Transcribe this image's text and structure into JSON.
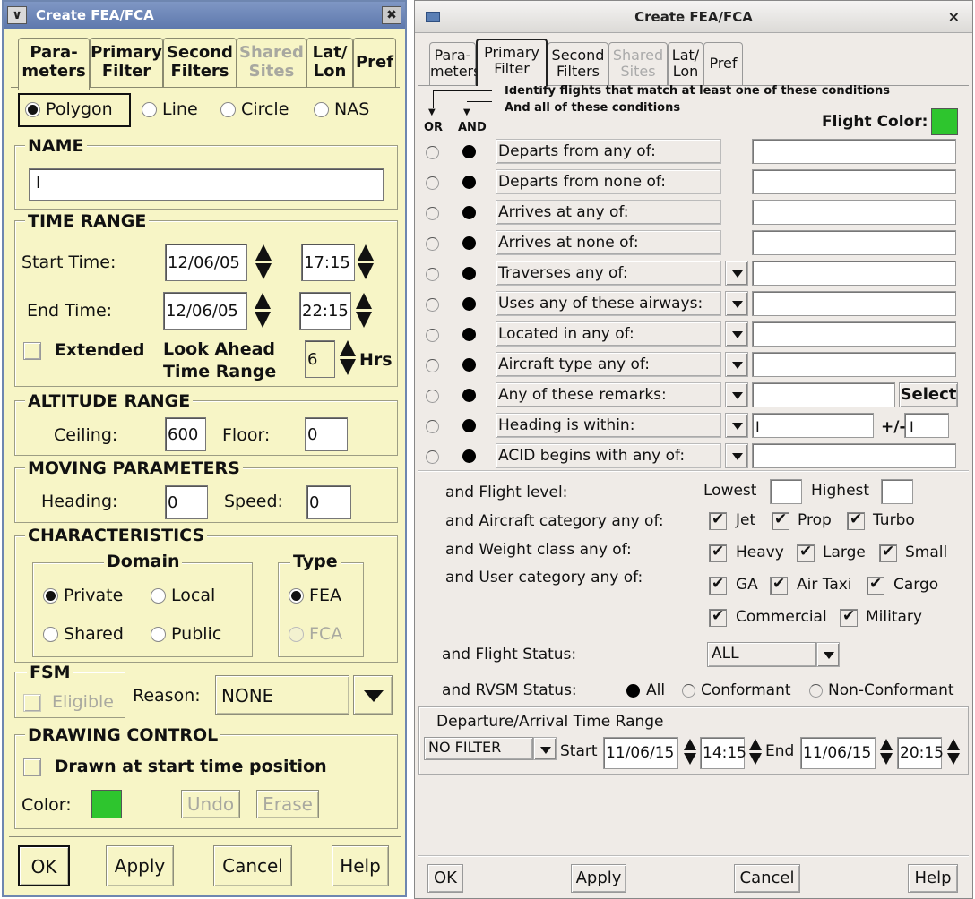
{
  "left_window": {
    "title": "Create FEA/FCA",
    "minimize_glyph": "∨",
    "close_glyph": "✖",
    "tabs": [
      {
        "label_line1": "Para-",
        "label_line2": "meters",
        "state": "active"
      },
      {
        "label_line1": "Primary",
        "label_line2": "Filter",
        "state": "normal"
      },
      {
        "label_line1": "Second",
        "label_line2": "Filters",
        "state": "normal"
      },
      {
        "label_line1": "Shared",
        "label_line2": "Sites",
        "state": "disabled"
      },
      {
        "label_line1": "Lat/",
        "label_line2": "Lon",
        "state": "normal"
      },
      {
        "label_line1": "Pref",
        "label_line2": "",
        "state": "normal"
      }
    ],
    "shape_options": [
      "Polygon",
      "Line",
      "Circle",
      "NAS"
    ],
    "shape_selected": "Polygon",
    "name_section": {
      "label": "NAME",
      "value": ""
    },
    "time_range": {
      "label": "TIME RANGE",
      "start_label": "Start Time:",
      "start_date": "12/06/05",
      "start_time": "17:15",
      "end_label": "End Time:",
      "end_date": "12/06/05",
      "end_time": "22:15",
      "extended_label": "Extended",
      "look_ahead_label_1": "Look Ahead",
      "look_ahead_label_2": "Time Range",
      "look_ahead_value": "6",
      "hrs_label": "Hrs"
    },
    "altitude_range": {
      "label": "ALTITUDE RANGE",
      "ceiling_label": "Ceiling:",
      "ceiling_value": "600",
      "floor_label": "Floor:",
      "floor_value": "0"
    },
    "moving_parameters": {
      "label": "MOVING PARAMETERS",
      "heading_label": "Heading:",
      "heading_value": "0",
      "speed_label": "Speed:",
      "speed_value": "0"
    },
    "characteristics": {
      "label": "CHARACTERISTICS",
      "domain_label": "Domain",
      "domain_options": [
        "Private",
        "Local",
        "Shared",
        "Public"
      ],
      "domain_selected": "Private",
      "type_label": "Type",
      "type_options": [
        "FEA",
        "FCA"
      ],
      "type_selected": "FEA"
    },
    "fsm": {
      "label": "FSM",
      "eligible_label": "Eligible",
      "reason_label": "Reason:",
      "reason_value": "NONE"
    },
    "drawing_control": {
      "label": "DRAWING CONTROL",
      "drawn_label": "Drawn at start time position",
      "color_label": "Color:",
      "color": "#2ec52e",
      "undo_label": "Undo",
      "erase_label": "Erase"
    },
    "buttons": {
      "ok": "OK",
      "apply": "Apply",
      "cancel": "Cancel",
      "help": "Help"
    }
  },
  "right_window": {
    "title": "Create FEA/FCA",
    "close_glyph": "×",
    "tabs": [
      {
        "label_line1": "Para-",
        "label_line2": "meters",
        "state": "normal"
      },
      {
        "label_line1": "Primary",
        "label_line2": "Filter",
        "state": "active"
      },
      {
        "label_line1": "Second",
        "label_line2": "Filters",
        "state": "normal"
      },
      {
        "label_line1": "Shared",
        "label_line2": "Sites",
        "state": "disabled"
      },
      {
        "label_line1": "Lat/",
        "label_line2": "Lon",
        "state": "normal"
      },
      {
        "label_line1": "Pref",
        "label_line2": "",
        "state": "normal"
      }
    ],
    "or_label": "OR",
    "and_label": "AND",
    "legend_line1": "Identify flights that match at least one of these conditions",
    "legend_line2": "And all of these conditions",
    "flight_color_label": "Flight Color:",
    "flight_color": "#2ec52e",
    "conditions": [
      {
        "label": "Departs from any of:",
        "dropdown": false,
        "value": ""
      },
      {
        "label": "Departs from none of:",
        "dropdown": false,
        "value": ""
      },
      {
        "label": "Arrives at any of:",
        "dropdown": false,
        "value": ""
      },
      {
        "label": "Arrives at none of:",
        "dropdown": false,
        "value": ""
      },
      {
        "label": "Traverses any of:",
        "dropdown": true,
        "value": ""
      },
      {
        "label": "Uses any of these airways:",
        "dropdown": true,
        "value": ""
      },
      {
        "label": "Located in any of:",
        "dropdown": true,
        "value": ""
      },
      {
        "label": "Aircraft type any of:",
        "dropdown": true,
        "value": ""
      },
      {
        "label": "Any of these remarks:",
        "dropdown": true,
        "value": ""
      },
      {
        "label": "Heading is within:",
        "dropdown": true,
        "value": ""
      },
      {
        "label": "ACID begins with any of:",
        "dropdown": true,
        "value": ""
      }
    ],
    "select_button": "Select",
    "plus_minus_label": "+/-",
    "flight_level_label": "and Flight level:",
    "lowest_label": "Lowest",
    "highest_label": "Highest",
    "aircraft_category_label": "and Aircraft category any of:",
    "aircraft_categories": [
      "Jet",
      "Prop",
      "Turbo"
    ],
    "weight_class_label": "and Weight class any of:",
    "weight_classes": [
      "Heavy",
      "Large",
      "Small"
    ],
    "user_category_label": "and User category any of:",
    "user_categories_row1": [
      "GA",
      "Air Taxi",
      "Cargo"
    ],
    "user_categories_row2": [
      "Commercial",
      "Military"
    ],
    "flight_status_label": "and Flight Status:",
    "flight_status_value": "ALL",
    "rvsm_label": "and RVSM Status:",
    "rvsm_options": [
      "All",
      "Conformant",
      "Non-Conformant"
    ],
    "rvsm_selected": "All",
    "dep_arr": {
      "label": "Departure/Arrival Time Range",
      "filter_value": "NO FILTER",
      "start_label": "Start",
      "start_date": "11/06/15",
      "start_time": "14:15",
      "end_label": "End",
      "end_date": "11/06/15",
      "end_time": "20:15"
    },
    "buttons": {
      "ok": "OK",
      "apply": "Apply",
      "cancel": "Cancel",
      "help": "Help"
    }
  }
}
